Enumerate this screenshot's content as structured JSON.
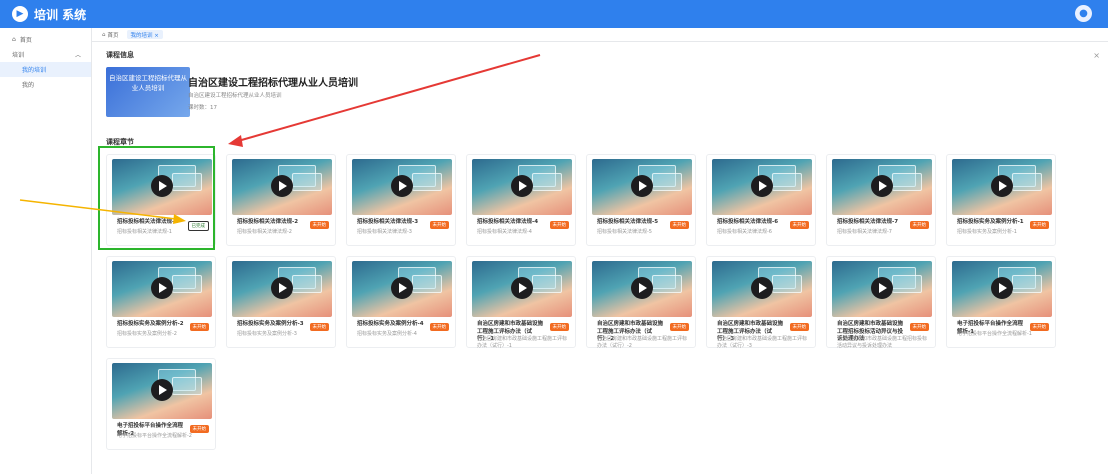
{
  "header": {
    "app_title": "培训 系统",
    "user_name": ""
  },
  "sidebar": {
    "items": [
      {
        "label": "首页",
        "type": "item"
      },
      {
        "label": "培训",
        "type": "group"
      },
      {
        "label": "我的培训",
        "type": "sub",
        "active": true
      },
      {
        "label": "我的",
        "type": "sub"
      }
    ]
  },
  "tabs": [
    {
      "label": "首页"
    },
    {
      "label": "我的培训 ×",
      "active": true
    }
  ],
  "course": {
    "section_info": "课程信息",
    "cover_text": "自治区建设工程招标代理从业人员培训",
    "name": "自治区建设工程招标代理从业人员培训",
    "desc": "自治区建设工程招标代理从业人员培训",
    "hours": "课时数：17"
  },
  "chapters_title": "课程章节",
  "chapters": [
    {
      "title": "招标投标相关法律法规-1",
      "sub": "招标投标相关法律法规-1",
      "status": "已完成"
    },
    {
      "title": "招标投标相关法律法规-2",
      "sub": "招标投标相关法律法规-2",
      "status": "未开始"
    },
    {
      "title": "招标投标相关法律法规-3",
      "sub": "招标投标相关法律法规-3",
      "status": "未开始"
    },
    {
      "title": "招标投标相关法律法规-4",
      "sub": "招标投标相关法律法规-4",
      "status": "未开始"
    },
    {
      "title": "招标投标相关法律法规-5",
      "sub": "招标投标相关法律法规-5",
      "status": "未开始"
    },
    {
      "title": "招标投标相关法律法规-6",
      "sub": "招标投标相关法律法规-6",
      "status": "未开始"
    },
    {
      "title": "招标投标相关法律法规-7",
      "sub": "招标投标相关法律法规-7",
      "status": "未开始"
    },
    {
      "title": "招标投标实务及案例分析-1",
      "sub": "招标投标实务及案例分析-1",
      "status": "未开始"
    },
    {
      "title": "招标投标实务及案例分析-2",
      "sub": "招标投标实务及案例分析-2",
      "status": "未开始"
    },
    {
      "title": "招标投标实务及案例分析-3",
      "sub": "招标投标实务及案例分析-3",
      "status": "未开始"
    },
    {
      "title": "招标投标实务及案例分析-4",
      "sub": "招标投标实务及案例分析-4",
      "status": "未开始"
    },
    {
      "title": "自治区房建和市政基础设施工程施工评标办法（试行）-1",
      "sub": "自治区房建和市政基础设施工程施工评标办法（试行）-1",
      "status": "未开始"
    },
    {
      "title": "自治区房建和市政基础设施工程施工评标办法（试行）-2",
      "sub": "自治区房建和市政基础设施工程施工评标办法（试行）-2",
      "status": "未开始"
    },
    {
      "title": "自治区房建和市政基础设施工程施工评标办法（试行）-3",
      "sub": "自治区房建和市政基础设施工程施工评标办法（试行）-3",
      "status": "未开始"
    },
    {
      "title": "自治区房建和市政基础设施工程招标投标活动异议与投诉处理办法",
      "sub": "自治区房建和市政基础设施工程招标投标活动异议与投诉处理办法",
      "status": "未开始"
    },
    {
      "title": "电子招投标平台操作全流程解析-1",
      "sub": "电子招投标平台操作全流程解析-1",
      "status": "未开始"
    },
    {
      "title": "电子招投标平台操作全流程解析-2",
      "sub": "电子招投标平台操作全流程解析-2",
      "status": "未开始"
    }
  ],
  "colors": {
    "primary": "#2f80ed",
    "badge_pending": "#f26b21",
    "highlight": "#2cb52c",
    "arrow_red": "#e53935",
    "arrow_yellow": "#f5b400"
  }
}
